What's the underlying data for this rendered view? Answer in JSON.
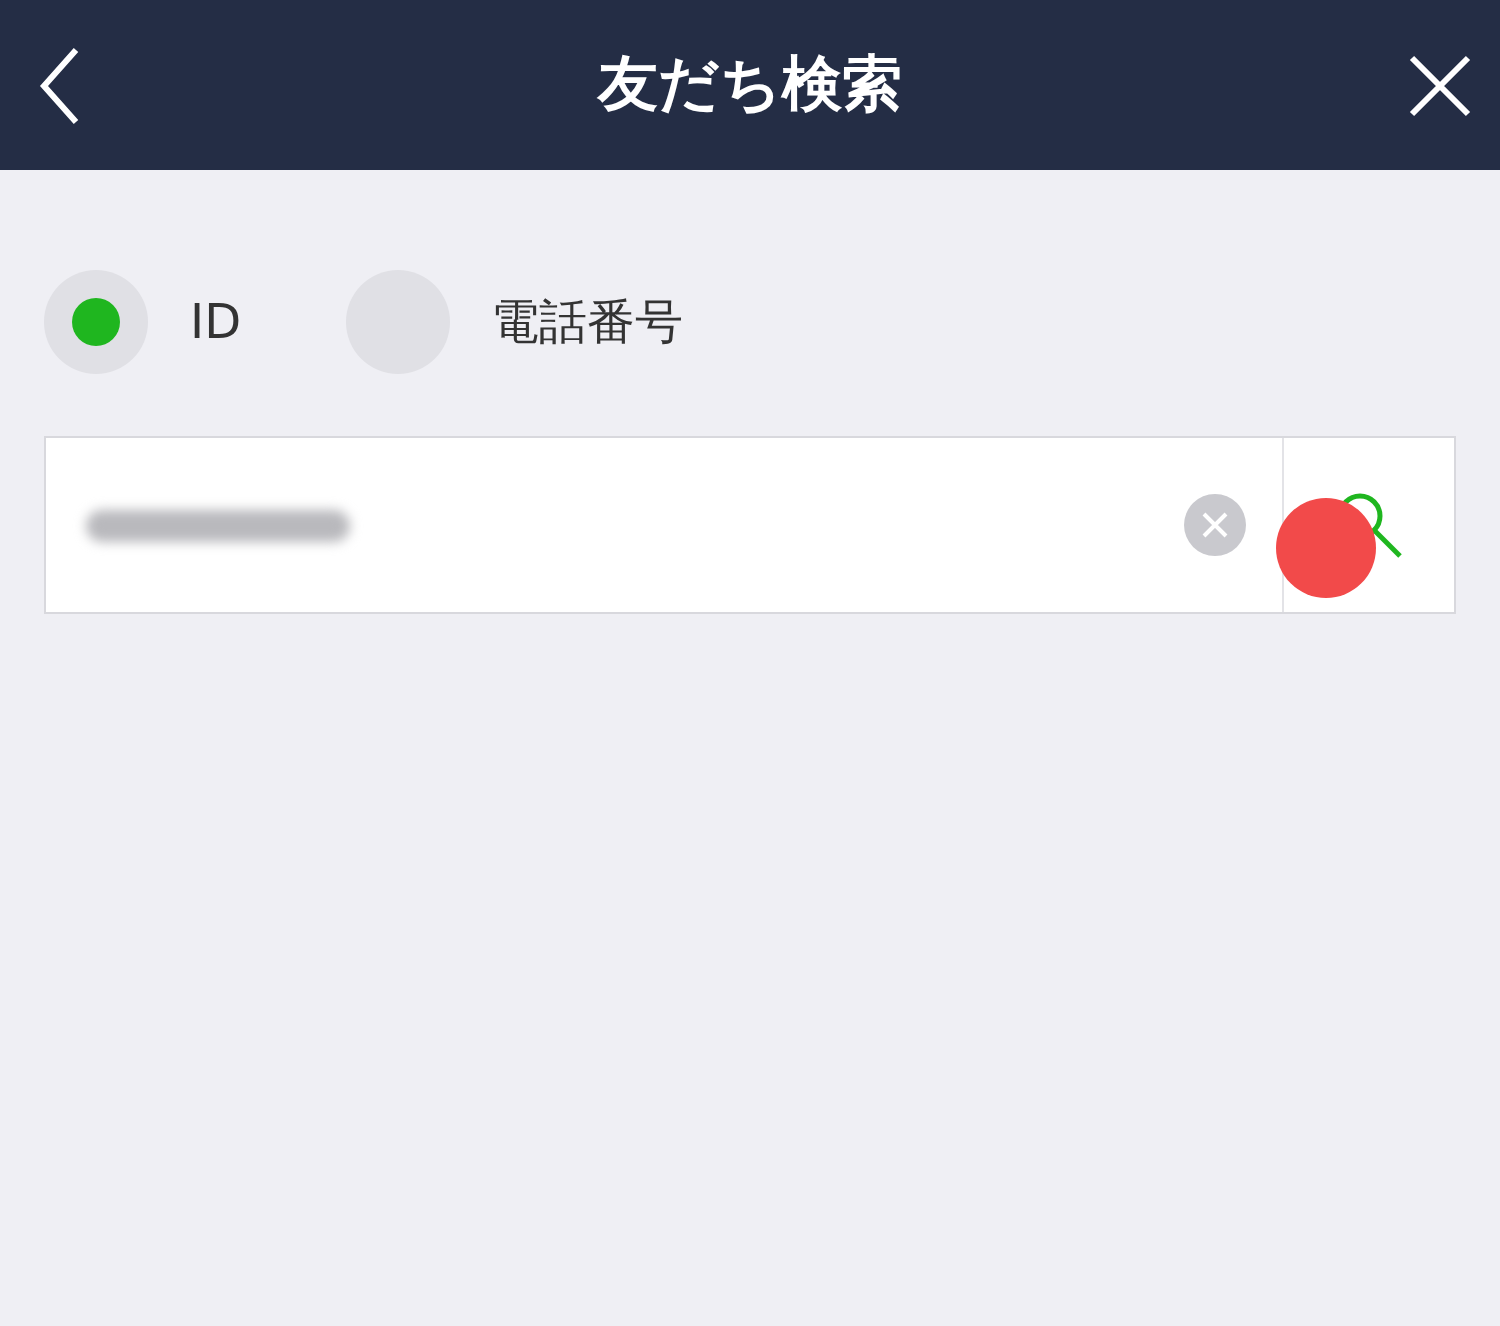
{
  "header": {
    "title": "友だち検索"
  },
  "search_type": [
    {
      "label": "ID",
      "selected": true
    },
    {
      "label": "電話番号",
      "selected": false
    }
  ],
  "search_field": {
    "value_redacted": true
  }
}
